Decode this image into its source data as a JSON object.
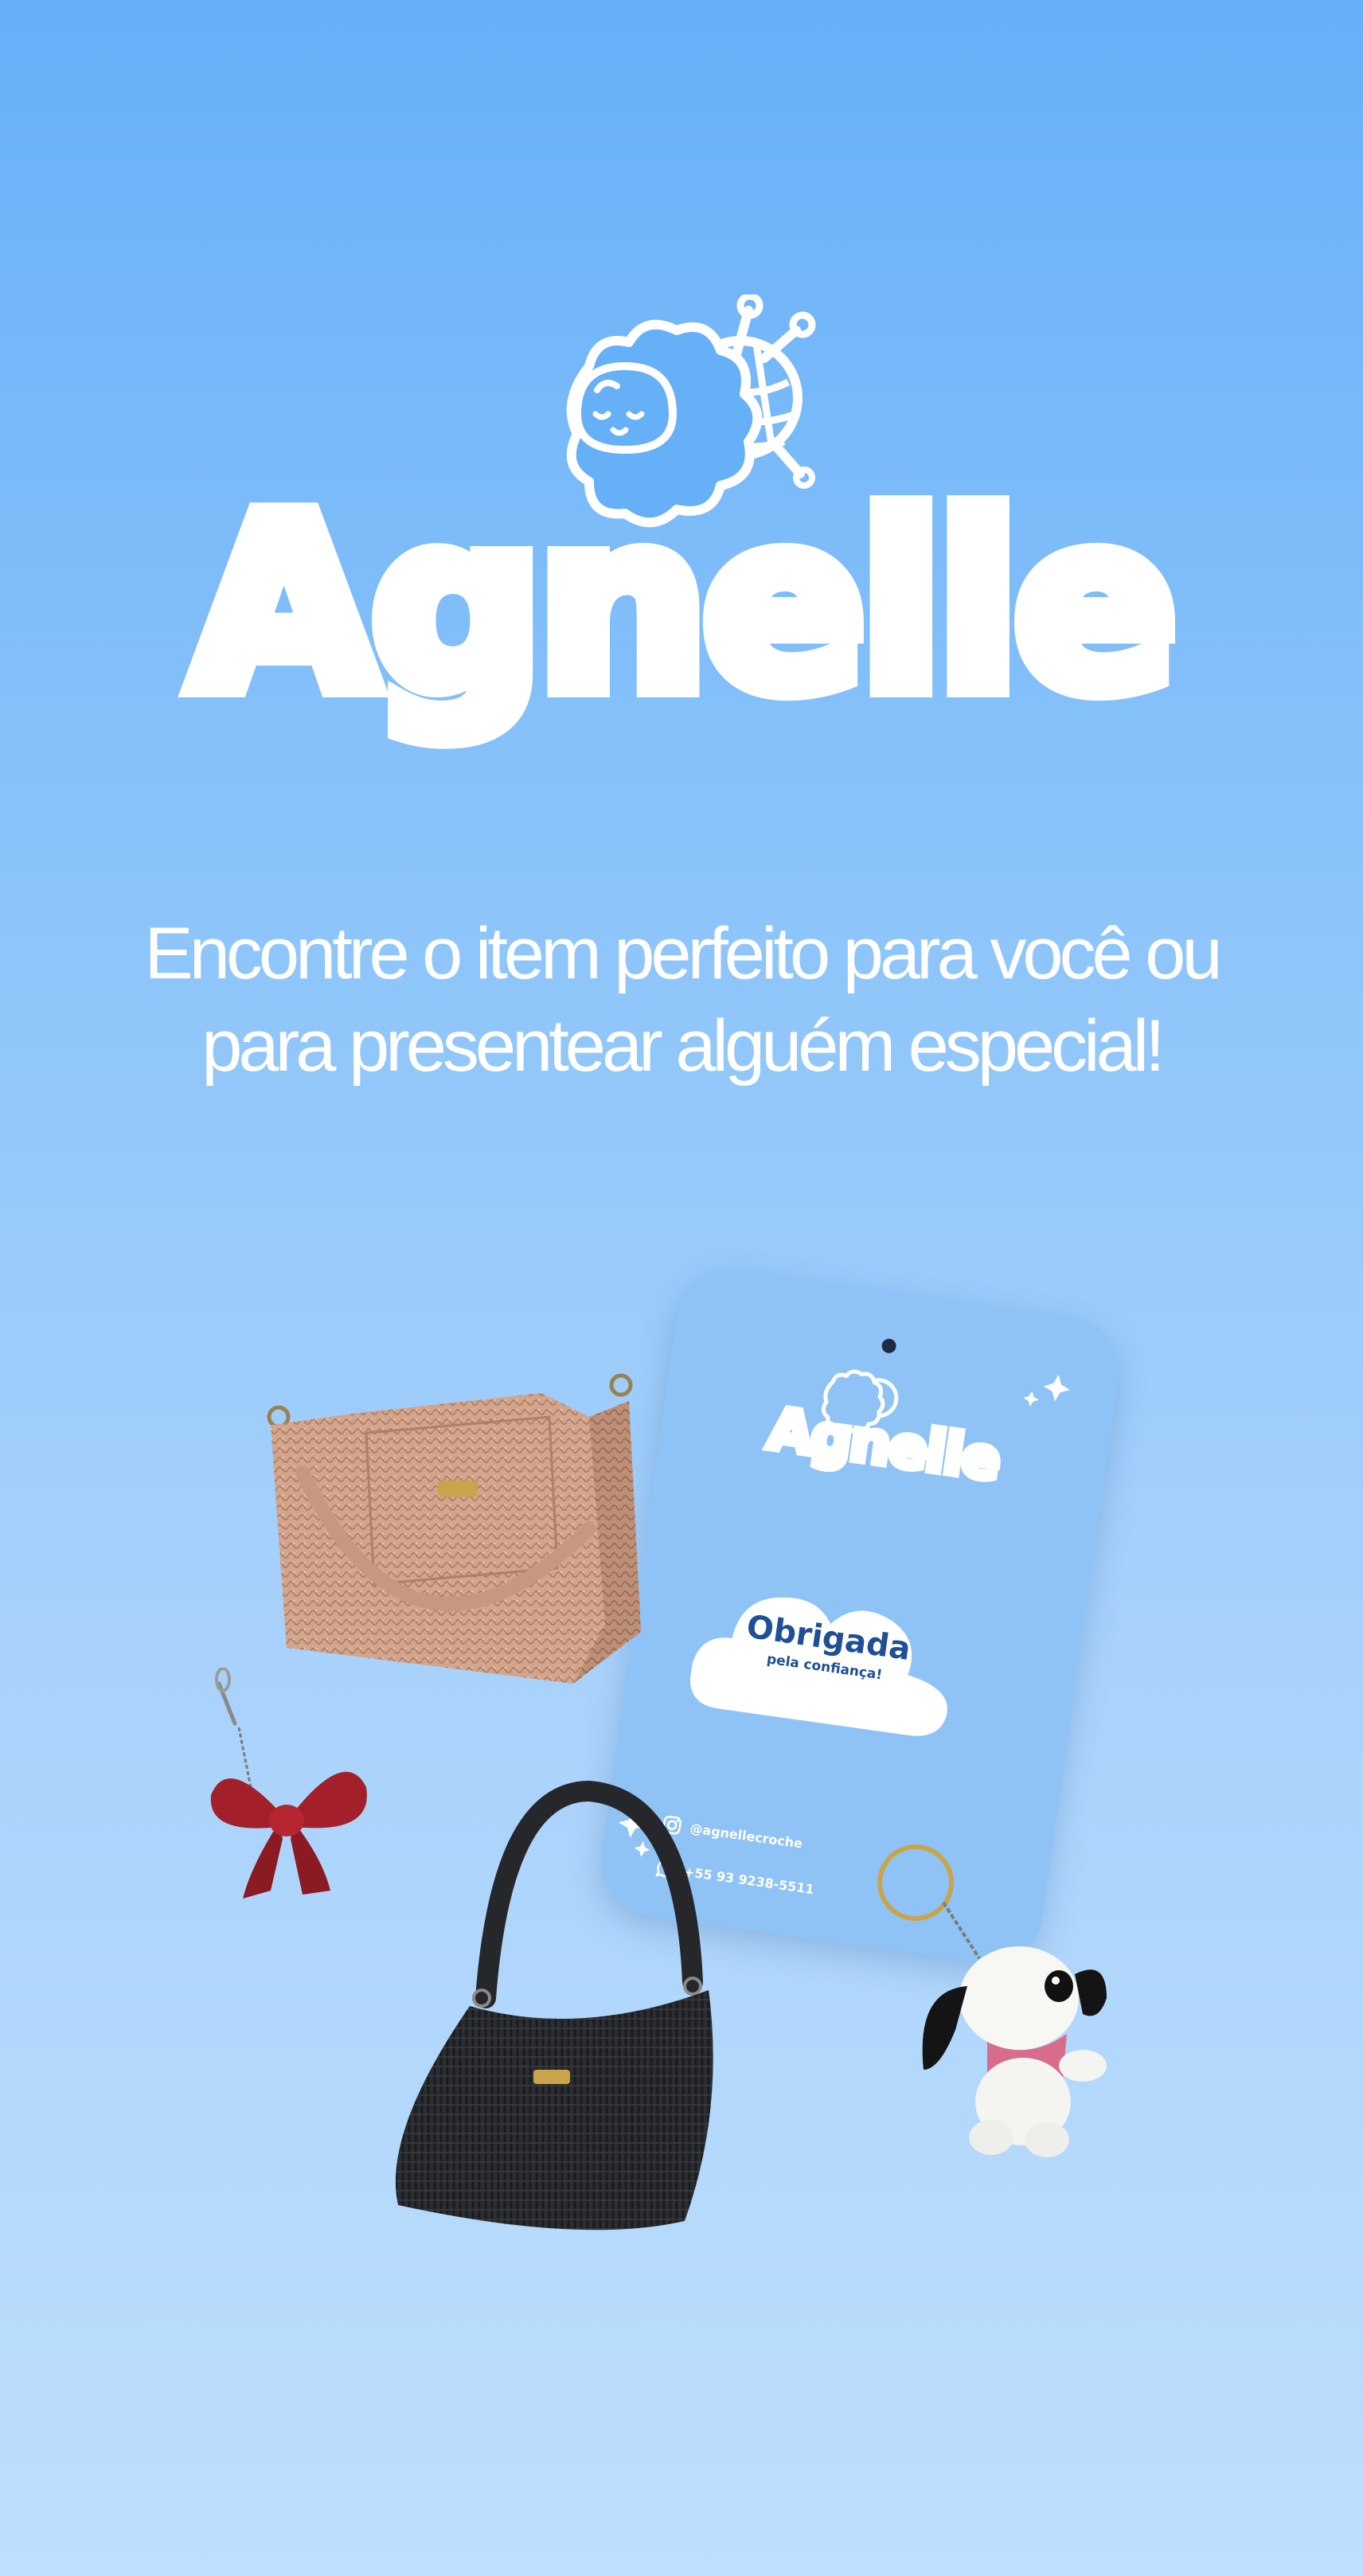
{
  "brand": {
    "name": "Agnelle",
    "logo_icon": "sheep-with-yarn-icon"
  },
  "tagline": {
    "line1": "Encontre o item perfeito para você ou",
    "line2": "para presentear alguém especial!"
  },
  "tag_card": {
    "brand_name": "Agnelle",
    "thanks_title": "Obrigada",
    "thanks_subtitle": "pela confiança!",
    "instagram": "@agnellecroche",
    "whatsapp": "+55 93 9238-5511"
  },
  "colors": {
    "background_top": "#66b0f8",
    "background_bottom": "#bedffd",
    "card": "#8fc3f6",
    "thanks_text": "#1f4f95"
  }
}
